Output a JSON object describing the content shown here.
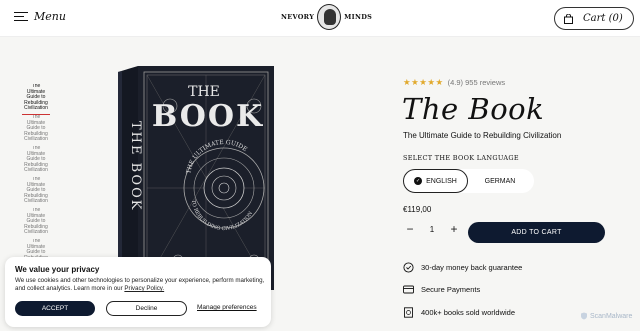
{
  "header": {
    "menu_label": "Menu",
    "logo_left": "NEVORY",
    "logo_right": "MINDS",
    "cart_label": "Cart (0)"
  },
  "gallery": {
    "thumbnails": [
      "The Ultimate Guide to Rebuilding Civilization",
      "The Ultimate Guide to Rebuilding Civilization",
      "The Ultimate Guide to Rebuilding Civilization",
      "The Ultimate Guide to Rebuilding Civilization",
      "The Ultimate Guide to Rebuilding Civilization",
      "The Ultimate Guide to Rebuilding Civilization"
    ],
    "cover": {
      "spine_title": "THE BOOK",
      "cover_the": "THE",
      "cover_book": "BOOK",
      "cover_arc_top": "THE ULTIMATE GUIDE",
      "cover_arc_bottom": "TO REBUILDING CIVILIZATION"
    }
  },
  "product": {
    "stars": "★★★★★",
    "rating_text": "(4.9) 955 reviews",
    "title": "The Book",
    "subtitle": "The Ultimate Guide to Rebuilding Civilization",
    "language_label": "SELECT THE BOOK LANGUAGE",
    "languages": [
      "ENGLISH",
      "GERMAN"
    ],
    "selected_language": "ENGLISH",
    "price": "€119,00",
    "quantity": "1",
    "add_to_cart": "ADD TO CART",
    "features": [
      "30-day money back guarantee",
      "Secure Payments",
      "400k+ books sold worldwide"
    ]
  },
  "cookie": {
    "title": "We value your privacy",
    "body": "We use cookies and other technologies to personalize your experience, perform marketing, and collect analytics. Learn more in our ",
    "link": "Privacy Policy.",
    "accept": "ACCEPT",
    "decline": "Decline",
    "manage": "Manage preferences"
  },
  "watermark": "ScanMalware",
  "colors": {
    "accent": "#0e1a30",
    "star": "#e1a92c",
    "background": "#f6f6f4"
  }
}
